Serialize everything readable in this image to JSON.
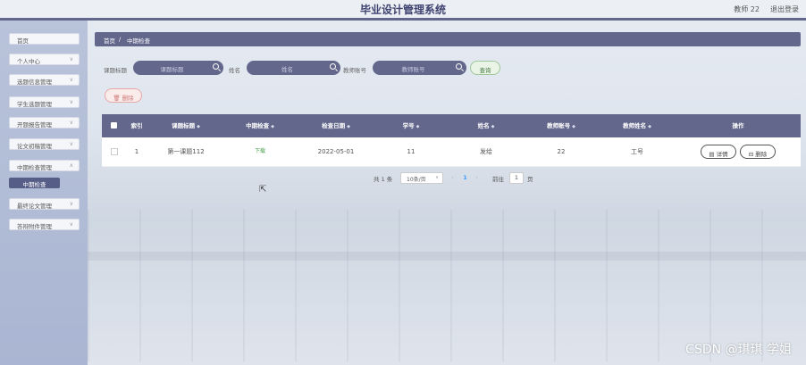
{
  "header": {
    "title": "毕业设计管理系统",
    "user": "教师 22",
    "logout": "退出登录"
  },
  "sidebar": {
    "items": [
      {
        "label": "首页",
        "has_chevron": false
      },
      {
        "label": "个人中心",
        "has_chevron": true
      },
      {
        "label": "选题信息管理",
        "has_chevron": true
      },
      {
        "label": "学生选题管理",
        "has_chevron": true
      },
      {
        "label": "开题报告管理",
        "has_chevron": true
      },
      {
        "label": "论文初稿管理",
        "has_chevron": true
      },
      {
        "label": "中期检查管理",
        "has_chevron": true
      },
      {
        "label": "最终论文管理",
        "has_chevron": true
      },
      {
        "label": "答辩附件管理",
        "has_chevron": true
      }
    ],
    "active_sub": "中期检查",
    "chevron_icon": "chevron-down-icon"
  },
  "breadcrumb": {
    "home": "首页",
    "sep": "/",
    "current": "中期检查"
  },
  "search": {
    "title_label": "课题标题",
    "title_placeholder": "课题标题",
    "name_label": "姓名",
    "name_placeholder": "姓名",
    "teacher_label": "教师账号",
    "teacher_placeholder": "教师账号",
    "query_label": "查询"
  },
  "toolbar": {
    "delete_label": "删除"
  },
  "table": {
    "columns": [
      "索引",
      "课题标题",
      "中期检查",
      "检查日期",
      "学号",
      "姓名",
      "教师账号",
      "教师姓名",
      "操作"
    ],
    "sort_icon": "◆",
    "rows": [
      {
        "index": "1",
        "title": "第一课题112",
        "check": "下载",
        "date": "2022-05-01",
        "student_id": "11",
        "name": "发给",
        "teacher_account": "22",
        "teacher_name": "工号"
      }
    ],
    "detail_label": "详情",
    "row_delete_label": "删除"
  },
  "pagination": {
    "total": "共 1 条",
    "page_size": "10条/页",
    "current_page": "1",
    "goto_label": "前往",
    "goto_value": "1",
    "page_suffix": "页"
  },
  "watermark": "CSDN @琪琪 学姐",
  "colors": {
    "primary": "#62678b",
    "sidebar": "#b3bdd6",
    "success": "#4aa14a",
    "danger": "#d07a7a"
  }
}
